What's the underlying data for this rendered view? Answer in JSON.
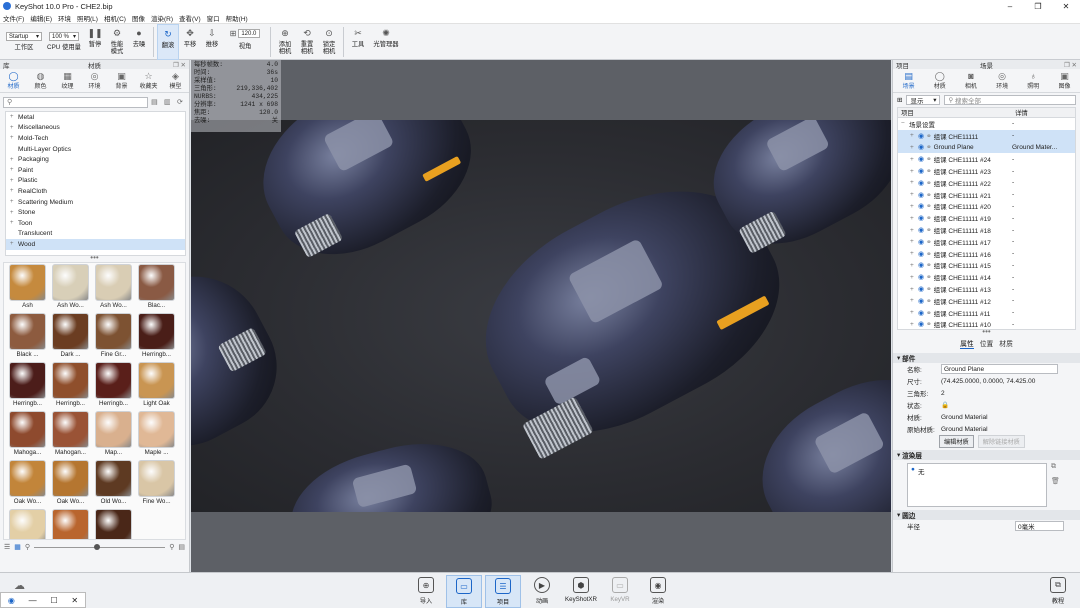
{
  "window": {
    "title": "KeyShot 10.0 Pro  - CHE2.bip",
    "minimize": "–",
    "maximize": "❐",
    "close": "✕"
  },
  "menu": [
    "文件(F)",
    "编辑(E)",
    "环境",
    "照明(L)",
    "相机(C)",
    "图像",
    "渲染(R)",
    "查看(V)",
    "窗口",
    "帮助(H)"
  ],
  "toolbar": {
    "workspace_value": "Startup",
    "workspace_label": "工作区",
    "cpu_value": "100 %",
    "cpu_label": "CPU 使用量",
    "pause": "暂停",
    "perf_mode": "性能\n模式",
    "denoise": "去噪",
    "tumble": "翻滚",
    "pan": "平移",
    "dolly": "推移",
    "fov_value": "120.0",
    "fov_label": "视角",
    "add_camera": "添加\n相机",
    "reset_camera": "重置\n相机",
    "lock_camera": "锁定\n相机",
    "tools": "工具",
    "light_manager": "光管理器"
  },
  "library": {
    "header_left": "库",
    "header_title": "材质",
    "tabs": [
      "材质",
      "颜色",
      "纹理",
      "环境",
      "背景",
      "收藏夹",
      "模型"
    ],
    "search_placeholder": "",
    "tree": [
      {
        "label": "Metal",
        "plus": true
      },
      {
        "label": "Miscellaneous",
        "plus": true
      },
      {
        "label": "Mold-Tech",
        "plus": true
      },
      {
        "label": "Multi-Layer Optics",
        "plus": false
      },
      {
        "label": "Packaging",
        "plus": true
      },
      {
        "label": "Paint",
        "plus": true
      },
      {
        "label": "Plastic",
        "plus": true
      },
      {
        "label": "RealCloth",
        "plus": true
      },
      {
        "label": "Scattering Medium",
        "plus": true
      },
      {
        "label": "Stone",
        "plus": true
      },
      {
        "label": "Toon",
        "plus": true
      },
      {
        "label": "Translucent",
        "plus": false
      },
      {
        "label": "Wood",
        "plus": true
      }
    ],
    "swatches": [
      {
        "name": "Ash",
        "color": "#c58a3e"
      },
      {
        "name": "Ash Wo...",
        "color": "#d8cfb8"
      },
      {
        "name": "Ash Wo...",
        "color": "#d9cdb4"
      },
      {
        "name": "Blac...",
        "color": "#8a5a44"
      },
      {
        "name": "Black ...",
        "color": "#8d5b3f"
      },
      {
        "name": "Dark ...",
        "color": "#6b3d22"
      },
      {
        "name": "Fine Gr...",
        "color": "#7d5232"
      },
      {
        "name": "Herringb...",
        "color": "#4a1e18"
      },
      {
        "name": "Herringb...",
        "color": "#4c1d1a"
      },
      {
        "name": "Herringb...",
        "color": "#8f4f2c"
      },
      {
        "name": "Herringb...",
        "color": "#5a1f1a"
      },
      {
        "name": "Light Oak",
        "color": "#c99552"
      },
      {
        "name": "Mahoga...",
        "color": "#8e4a2e"
      },
      {
        "name": "Mahogan...",
        "color": "#9a5336"
      },
      {
        "name": "Map...",
        "color": "#d9b08e"
      },
      {
        "name": "Maple ...",
        "color": "#e0b896"
      },
      {
        "name": "Oak Wo...",
        "color": "#c2853a"
      },
      {
        "name": "Oak Wo...",
        "color": "#b57630"
      },
      {
        "name": "Old Wo...",
        "color": "#5e3a22"
      },
      {
        "name": "Fine Wo...",
        "color": "#d9c6a6"
      },
      {
        "name": "",
        "color": "#e3cfa6"
      },
      {
        "name": "",
        "color": "#b9652e"
      },
      {
        "name": "",
        "color": "#4a2718"
      }
    ]
  },
  "stats": [
    {
      "k": "每秒帧数:",
      "v": "4.0"
    },
    {
      "k": "时间:",
      "v": "36s"
    },
    {
      "k": "采样值:",
      "v": "10"
    },
    {
      "k": "三角形:",
      "v": "219,336,402"
    },
    {
      "k": "NURBS:",
      "v": "434,225"
    },
    {
      "k": "分辨率:",
      "v": "1241 x 698"
    },
    {
      "k": "焦距:",
      "v": "120.0"
    },
    {
      "k": "去噪:",
      "v": "关"
    }
  ],
  "project": {
    "header_left": "项目",
    "header_title": "场景",
    "tabs": [
      "场景",
      "材质",
      "相机",
      "环境",
      "照明",
      "图像"
    ],
    "view_select": "显示",
    "search_placeholder": "搜索全部",
    "col_item": "项目",
    "col_detail": "详情",
    "rows": [
      {
        "label": "场景设置",
        "detail": "-",
        "sel": false,
        "indent": 0,
        "eye": false
      },
      {
        "label": "组课 CHE11111",
        "detail": "-",
        "sel": true,
        "indent": 1,
        "eye": true
      },
      {
        "label": "Ground Plane",
        "detail": "Ground Mater...",
        "sel": true,
        "indent": 1,
        "eye": true
      },
      {
        "label": "组课 CHE11111 #24",
        "detail": "-",
        "sel": false,
        "indent": 1,
        "eye": true
      },
      {
        "label": "组课 CHE11111 #23",
        "detail": "-",
        "sel": false,
        "indent": 1,
        "eye": true
      },
      {
        "label": "组课 CHE11111 #22",
        "detail": "-",
        "sel": false,
        "indent": 1,
        "eye": true
      },
      {
        "label": "组课 CHE11111 #21",
        "detail": "-",
        "sel": false,
        "indent": 1,
        "eye": true
      },
      {
        "label": "组课 CHE11111 #20",
        "detail": "-",
        "sel": false,
        "indent": 1,
        "eye": true
      },
      {
        "label": "组课 CHE11111 #19",
        "detail": "-",
        "sel": false,
        "indent": 1,
        "eye": true
      },
      {
        "label": "组课 CHE11111 #18",
        "detail": "-",
        "sel": false,
        "indent": 1,
        "eye": true
      },
      {
        "label": "组课 CHE11111 #17",
        "detail": "-",
        "sel": false,
        "indent": 1,
        "eye": true
      },
      {
        "label": "组课 CHE11111 #16",
        "detail": "-",
        "sel": false,
        "indent": 1,
        "eye": true
      },
      {
        "label": "组课 CHE11111 #15",
        "detail": "-",
        "sel": false,
        "indent": 1,
        "eye": true
      },
      {
        "label": "组课 CHE11111 #14",
        "detail": "-",
        "sel": false,
        "indent": 1,
        "eye": true
      },
      {
        "label": "组课 CHE11111 #13",
        "detail": "-",
        "sel": false,
        "indent": 1,
        "eye": true
      },
      {
        "label": "组课 CHE11111 #12",
        "detail": "-",
        "sel": false,
        "indent": 1,
        "eye": true
      },
      {
        "label": "组课 CHE11111 #11",
        "detail": "-",
        "sel": false,
        "indent": 1,
        "eye": true
      },
      {
        "label": "组课 CHE11111 #10",
        "detail": "-",
        "sel": false,
        "indent": 1,
        "eye": true
      }
    ],
    "prop_tabs": [
      "属性",
      "位置",
      "材质"
    ],
    "geometry_title": "部件",
    "name_label": "名称:",
    "name_value": "Ground Plane",
    "size_label": "尺寸:",
    "size_value": "(74.425.0000, 0.0000, 74.425.00",
    "tri_label": "三角形:",
    "tri_value": "2",
    "state_label": "状态:",
    "state_value": "🔒",
    "mat_label": "材质:",
    "mat_value": "Ground Material",
    "orig_mat_label": "原始材质:",
    "orig_mat_value": "Ground Material",
    "edit_mat_button": "编辑材质",
    "unlink_button": "解除链接材质",
    "render_layers_title": "渲染层",
    "layer_none": "无",
    "rounding_title": "圆边",
    "radius_label": "半径",
    "radius_value": "0毫米"
  },
  "bottom": {
    "import": "导入",
    "library": "库",
    "project": "项目",
    "animation": "动画",
    "keyshotxr": "KeyShotXR",
    "keyvr": "KeyVR",
    "render": "渲染",
    "tutorial": "教程"
  }
}
